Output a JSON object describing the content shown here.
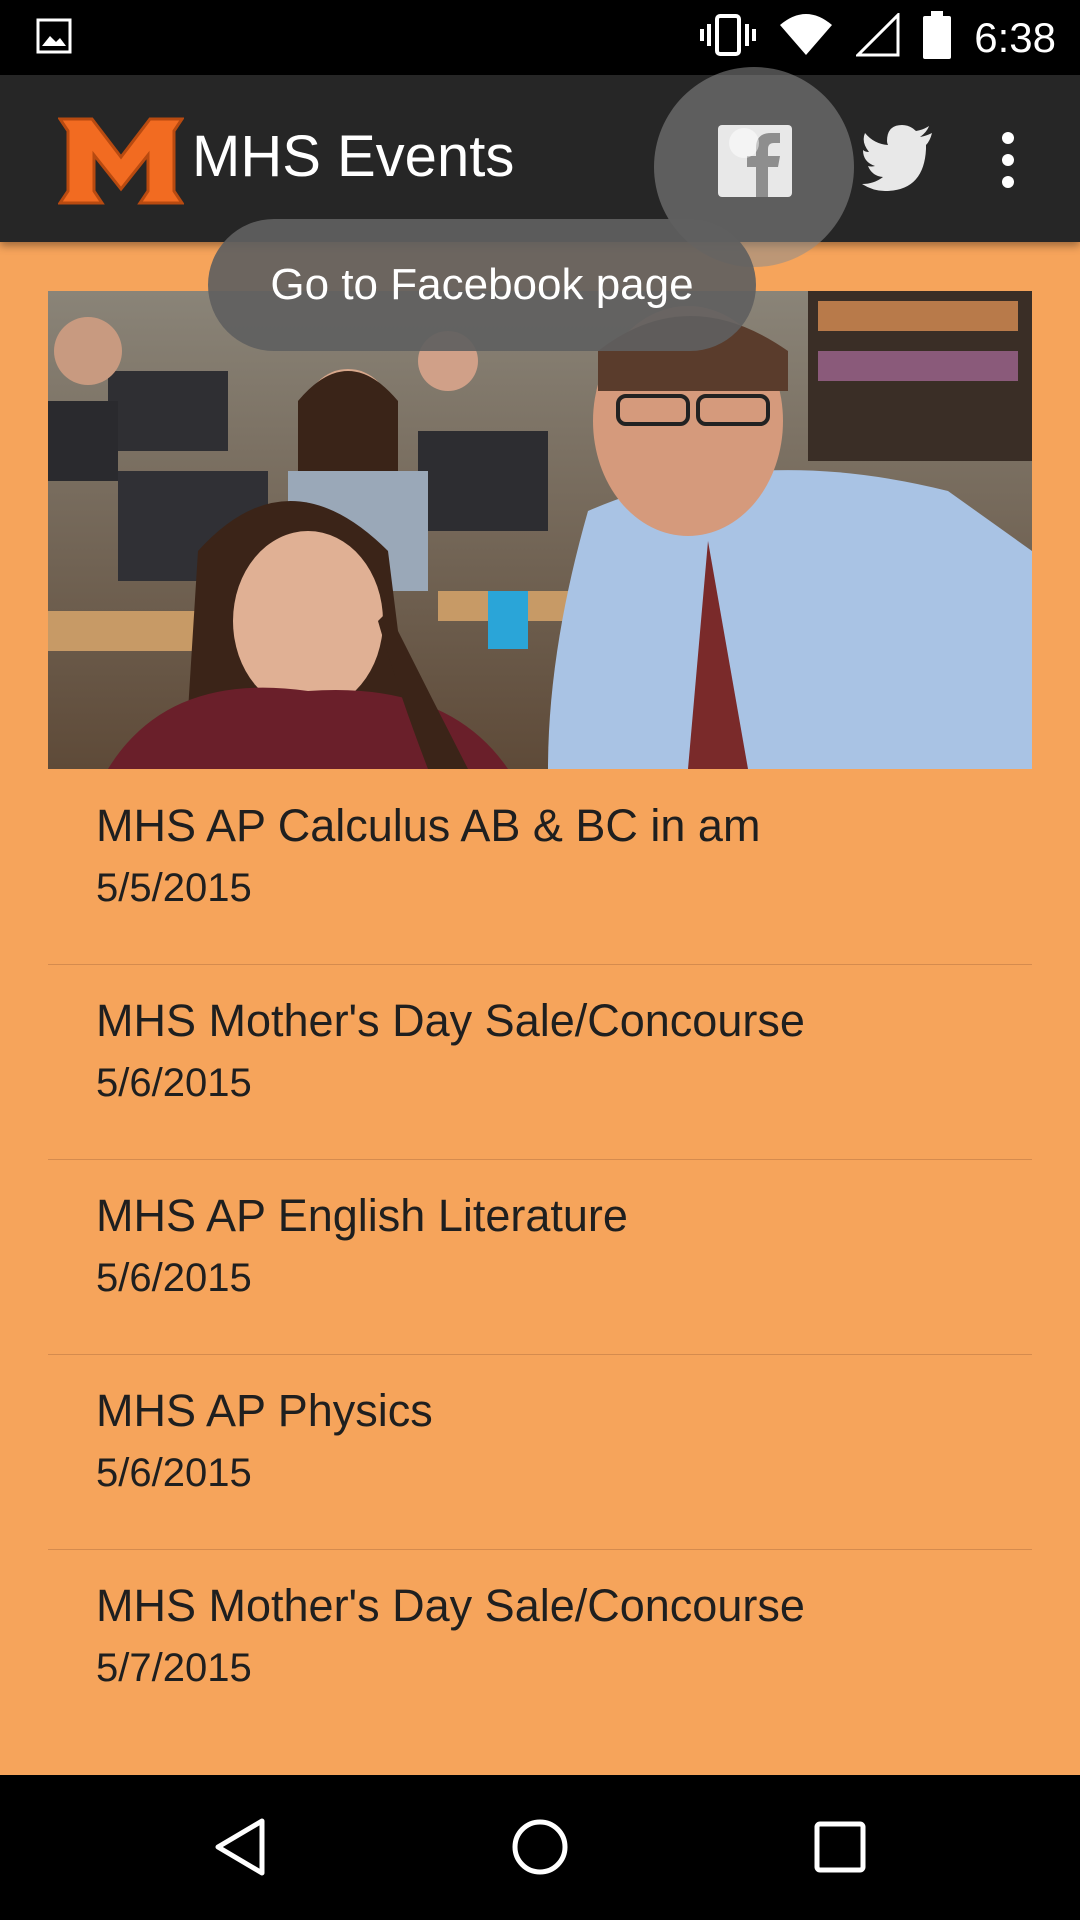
{
  "status_bar": {
    "time": "6:38",
    "icons": [
      "image-icon",
      "vibrate-icon",
      "wifi-icon",
      "signal-icon",
      "battery-icon"
    ]
  },
  "app_bar": {
    "title": "MHS Events",
    "logo_letter": "M",
    "actions": [
      "facebook-icon",
      "twitter-icon",
      "more-options-icon"
    ]
  },
  "tooltip": {
    "text": "Go to Facebook page"
  },
  "events": [
    {
      "title": "MHS AP Calculus AB & BC in am",
      "date": "5/5/2015"
    },
    {
      "title": "MHS Mother's Day Sale/Concourse",
      "date": "5/6/2015"
    },
    {
      "title": "MHS AP English Literature",
      "date": "5/6/2015"
    },
    {
      "title": "MHS AP Physics",
      "date": "5/6/2015"
    },
    {
      "title": "MHS Mother's Day Sale/Concourse",
      "date": "5/7/2015"
    }
  ],
  "nav_bar": {
    "buttons": [
      "back-icon",
      "home-icon",
      "recents-icon"
    ]
  },
  "colors": {
    "background": "#f6a45b",
    "app_bar": "#262626",
    "logo_orange": "#f26b21"
  }
}
